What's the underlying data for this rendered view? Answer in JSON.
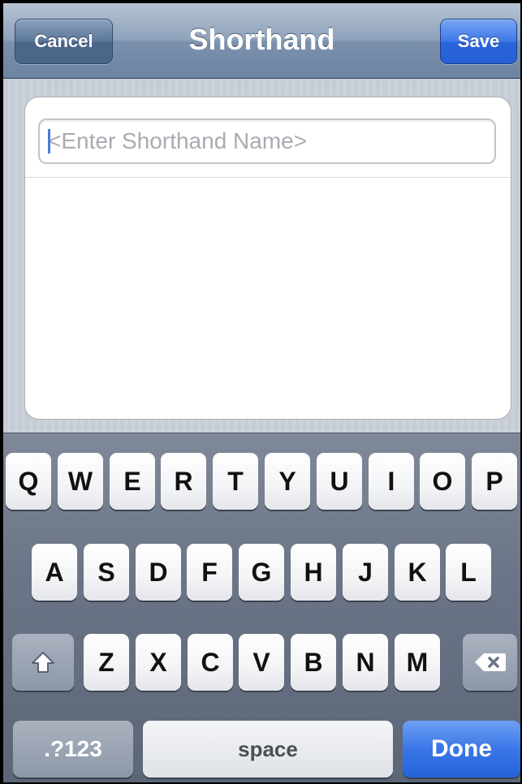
{
  "navbar": {
    "title": "Shorthand",
    "cancel_label": "Cancel",
    "save_label": "Save"
  },
  "form": {
    "name_placeholder": "<Enter Shorthand Name>",
    "name_value": ""
  },
  "keyboard": {
    "row1": [
      "Q",
      "W",
      "E",
      "R",
      "T",
      "Y",
      "U",
      "I",
      "O",
      "P"
    ],
    "row2": [
      "A",
      "S",
      "D",
      "F",
      "G",
      "H",
      "J",
      "K",
      "L"
    ],
    "row3": [
      "Z",
      "X",
      "C",
      "V",
      "B",
      "N",
      "M"
    ],
    "shift_icon": "shift-icon",
    "backspace_icon": "backspace-icon",
    "numbers_label": ".?123",
    "space_label": "space",
    "done_label": "Done"
  },
  "colors": {
    "nav_bar": "#7b91ad",
    "save_button": "#2a64da",
    "done_button": "#3a76e6",
    "keyboard_bg": "#6b7587"
  }
}
